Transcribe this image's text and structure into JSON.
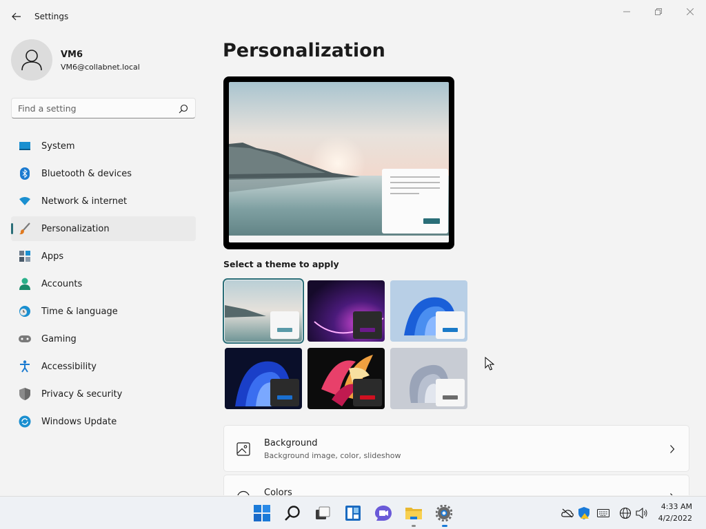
{
  "window": {
    "title": "Settings"
  },
  "user": {
    "name": "VM6",
    "email": "VM6@collabnet.local"
  },
  "search": {
    "placeholder": "Find a setting"
  },
  "nav": [
    {
      "label": "System",
      "icon": "monitor-icon",
      "active": false
    },
    {
      "label": "Bluetooth & devices",
      "icon": "bluetooth-icon",
      "active": false
    },
    {
      "label": "Network & internet",
      "icon": "wifi-icon",
      "active": false
    },
    {
      "label": "Personalization",
      "icon": "brush-icon",
      "active": true
    },
    {
      "label": "Apps",
      "icon": "apps-icon",
      "active": false
    },
    {
      "label": "Accounts",
      "icon": "person-icon",
      "active": false
    },
    {
      "label": "Time & language",
      "icon": "clock-globe-icon",
      "active": false
    },
    {
      "label": "Gaming",
      "icon": "gamepad-icon",
      "active": false
    },
    {
      "label": "Accessibility",
      "icon": "accessibility-icon",
      "active": false
    },
    {
      "label": "Privacy & security",
      "icon": "shield-icon",
      "active": false
    },
    {
      "label": "Windows Update",
      "icon": "update-icon",
      "active": false
    }
  ],
  "main": {
    "title": "Personalization",
    "theme_label": "Select a theme to apply",
    "themes": [
      {
        "name": "glow-lake",
        "selected": true,
        "accent": "#5a9aa8"
      },
      {
        "name": "dark-purple-glow",
        "selected": false,
        "accent": "#6b1a8a"
      },
      {
        "name": "light-bloom",
        "selected": false,
        "accent": "#1a7ac8"
      },
      {
        "name": "dark-bloom",
        "selected": false,
        "accent": "#1a6fd0"
      },
      {
        "name": "captured-motion",
        "selected": false,
        "accent": "#d01020"
      },
      {
        "name": "flow",
        "selected": false,
        "accent": "#6b6b6b"
      }
    ],
    "cards": [
      {
        "title": "Background",
        "subtitle": "Background image, color, slideshow",
        "icon": "image-icon"
      },
      {
        "title": "Colors",
        "subtitle": "",
        "icon": "palette-icon"
      }
    ]
  },
  "taskbar": {
    "apps": [
      "start-icon",
      "search-icon",
      "task-view-icon",
      "widgets-icon",
      "chat-icon",
      "file-explorer-icon",
      "settings-icon"
    ],
    "time": "4:33 AM",
    "date": "4/2/2022"
  },
  "colors": {
    "accent": "#2a6e78",
    "background": "#f3f3f3"
  }
}
